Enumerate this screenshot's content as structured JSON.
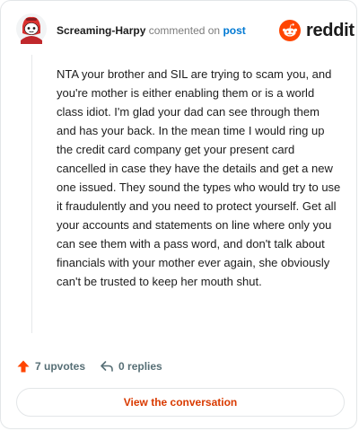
{
  "header": {
    "username": "Screaming-Harpy",
    "commented_on": "commented on",
    "post_link": "post",
    "brand": "reddit"
  },
  "comment": {
    "body": "NTA your brother and SIL are trying to scam you, and you're mother is either enabling them or is a world class idiot. I'm glad your dad can see through them and has your back. In the mean time I would ring up the credit card company get your present card cancelled in case they have the details and get a new one issued. They sound the types who would try to use it fraudulently and you need to protect yourself. Get all your accounts and statements on line where only you can see them with a pass word, and don't talk about financials with your mother ever again, she obviously can't be trusted to keep her mouth shut."
  },
  "footer": {
    "upvotes": "7 upvotes",
    "replies": "0 replies",
    "view_button": "View the conversation"
  },
  "colors": {
    "brand_orange": "#ff4500",
    "link_blue": "#0079d3",
    "button_text": "#d93a00",
    "muted": "#576f76"
  },
  "icons": {
    "avatar": "snoo-avatar-red",
    "brand": "reddit-snoo-logo-icon",
    "upvote": "upvote-arrow-icon",
    "reply": "reply-arrow-icon"
  }
}
